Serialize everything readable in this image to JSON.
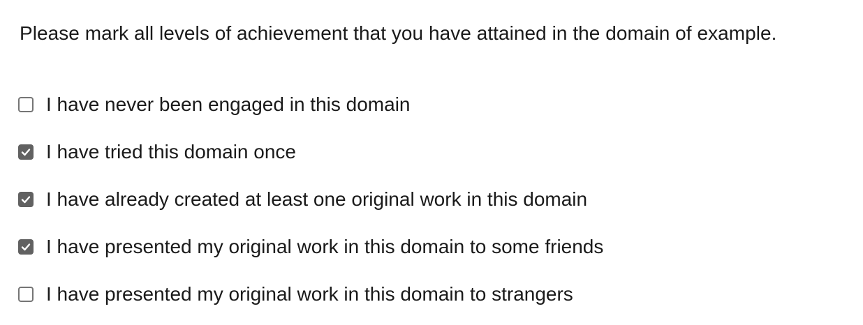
{
  "question": {
    "text": "Please mark all levels of achievement that you have attained in the domain of example."
  },
  "options": [
    {
      "label": "I have never been engaged in this domain",
      "checked": false
    },
    {
      "label": "I have tried this domain once",
      "checked": true
    },
    {
      "label": "I have already created at least one original work in this domain",
      "checked": true
    },
    {
      "label": "I have presented my original work in this domain to some friends",
      "checked": true
    },
    {
      "label": "I have presented my original work in this domain to strangers",
      "checked": false
    }
  ],
  "colors": {
    "checkbox_checked": "#616161",
    "checkbox_border": "#757575",
    "text": "#1a1a1a"
  },
  "icons": {
    "checked": "checkmark-icon"
  }
}
